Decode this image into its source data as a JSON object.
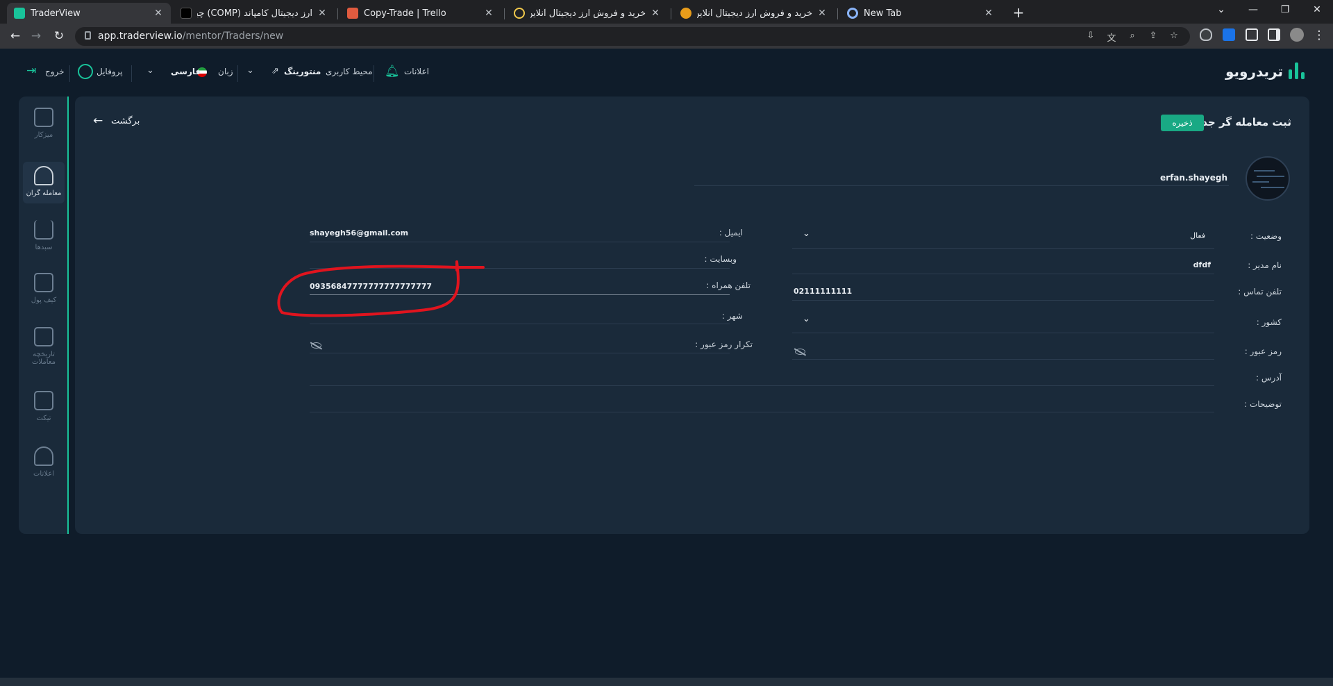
{
  "browser": {
    "tabs": [
      {
        "title": "TraderView",
        "favicon_color": "#19c39a",
        "active": true
      },
      {
        "title": "ارز دیجیتال کامپاند (COMP) چیست؟",
        "favicon_color": "#000000",
        "active": false
      },
      {
        "title": "Copy-Trade | Trello",
        "favicon_color": "#e05b3f",
        "active": false
      },
      {
        "title": "خرید و فروش ارز دیجیتال آنلاین zari",
        "favicon_color": "#f2c94c",
        "active": false
      },
      {
        "title": "خرید و فروش ارز دیجیتال آنلاین زربیـ",
        "favicon_color": "#e89c1a",
        "active": false
      },
      {
        "title": "New Tab",
        "favicon_color": "#8ab4f8",
        "active": false
      }
    ],
    "url_host": "app.traderview.io",
    "url_path": "/mentor/Traders/new",
    "close_glyph": "✕",
    "newtab_glyph": "+"
  },
  "header": {
    "brand": "تریدرویو",
    "notifications": "اعلانات",
    "workspace_label": "محیط کاربری",
    "workspace_value": "منتورینگ",
    "language_label": "زبان",
    "language_value": "فارسی",
    "profile": "پروفایل",
    "logout": "خروج"
  },
  "sidebar": {
    "items": [
      {
        "label": "میزکار",
        "icon": "desk-icon"
      },
      {
        "label": "معامله گران",
        "icon": "traders-icon",
        "active": true
      },
      {
        "label": "سبدها",
        "icon": "basket-icon"
      },
      {
        "label": "کیف پول",
        "icon": "wallet-icon"
      },
      {
        "label": "تاریخچه معاملات",
        "icon": "history-icon"
      },
      {
        "label": "تیکت",
        "icon": "ticket-icon"
      },
      {
        "label": "اعلانات",
        "icon": "bell-icon"
      }
    ]
  },
  "form": {
    "title": "ثبت معامله گر جدید",
    "save": "ذخیره",
    "back": "برگشت",
    "username": "erfan.shayegh",
    "fields": {
      "status": {
        "label": "وضعیت :",
        "value": "فعال"
      },
      "manager": {
        "label": "نام مدیر :",
        "value": "dfdf"
      },
      "phone": {
        "label": "تلفن تماس :",
        "value": "02111111111"
      },
      "country": {
        "label": "کشور :",
        "value": ""
      },
      "password": {
        "label": "رمز عبور :",
        "value": ""
      },
      "address": {
        "label": "آدرس :",
        "value": ""
      },
      "description": {
        "label": "توضیحات :",
        "value": ""
      },
      "email": {
        "label": "ایمیل :",
        "value": "shayegh56@gmail.com"
      },
      "website": {
        "label": "وبسایت :",
        "value": ""
      },
      "mobile": {
        "label": "تلفن همراه :",
        "value": "09356847777777777777777"
      },
      "city": {
        "label": "شهر :",
        "value": ""
      },
      "password_repeat": {
        "label": "تکرار رمز عبور :",
        "value": ""
      }
    }
  },
  "colors": {
    "accent": "#19c39a",
    "background": "#0f1c2a",
    "panel": "#1a2a3a",
    "annotation": "#e0141e"
  }
}
